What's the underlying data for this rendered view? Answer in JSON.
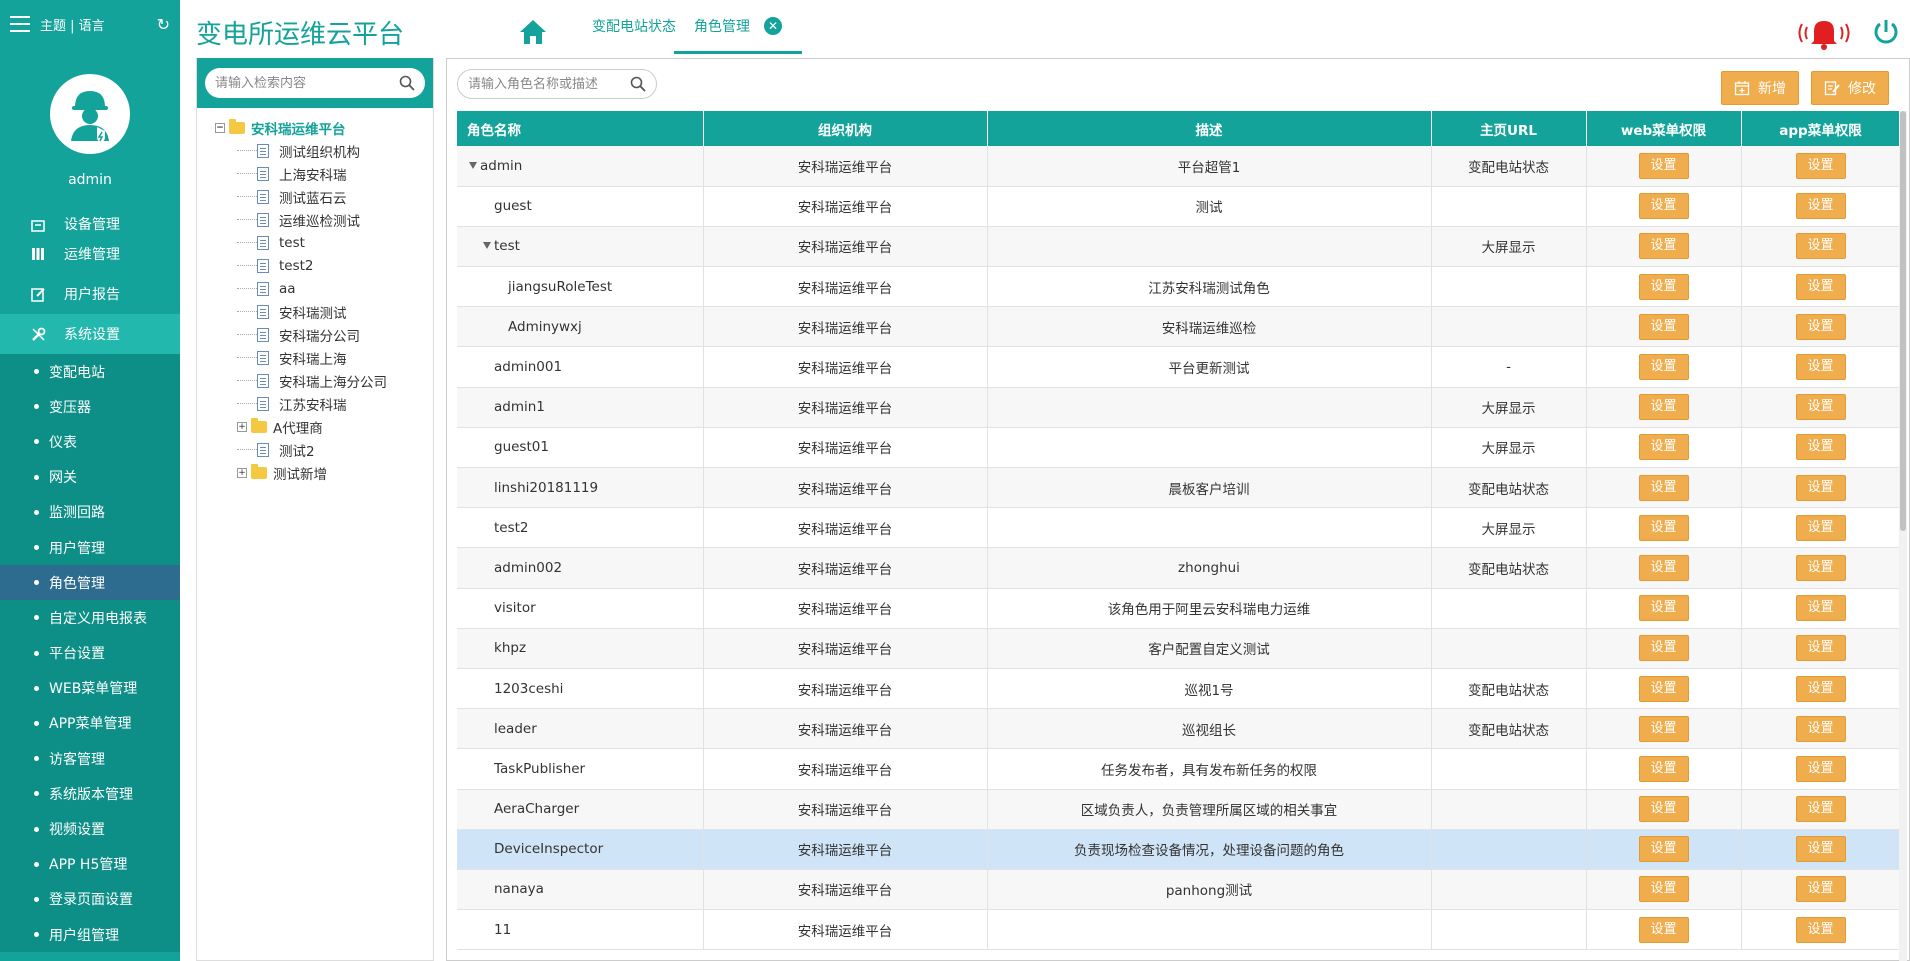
{
  "colors": {
    "brand": "#14a39a",
    "button": "#f0ad4e",
    "active_sub": "#2d6b8f",
    "selected_row": "#cfe4f6"
  },
  "sidebar": {
    "top_label": "主题 | 语言",
    "username": "admin",
    "main_menu": [
      {
        "label": "设备管理",
        "icon": "device-icon"
      },
      {
        "label": "运维管理",
        "icon": "grid-icon"
      },
      {
        "label": "用户报告",
        "icon": "edit-icon"
      },
      {
        "label": "系统设置",
        "icon": "tools-icon"
      }
    ],
    "sub_menu": [
      "变配电站",
      "变压器",
      "仪表",
      "网关",
      "监测回路",
      "用户管理",
      "角色管理",
      "自定义用电报表",
      "平台设置",
      "WEB菜单管理",
      "APP菜单管理",
      "访客管理",
      "系统版本管理",
      "视频设置",
      "APP H5管理",
      "登录页面设置",
      "用户组管理"
    ],
    "active_sub": "角色管理"
  },
  "header": {
    "title": "变电所运维云平台",
    "tabs": [
      {
        "label": "变配电站状态"
      },
      {
        "label": "角色管理"
      }
    ]
  },
  "tree": {
    "search_placeholder": "请输入检索内容",
    "root": "安科瑞运维平台",
    "nodes": [
      {
        "label": "测试组织机构",
        "type": "doc"
      },
      {
        "label": "上海安科瑞",
        "type": "doc"
      },
      {
        "label": "测试蓝石云",
        "type": "doc"
      },
      {
        "label": "运维巡检测试",
        "type": "doc"
      },
      {
        "label": "test",
        "type": "doc"
      },
      {
        "label": "test2",
        "type": "doc"
      },
      {
        "label": "aa",
        "type": "doc"
      },
      {
        "label": "安科瑞测试",
        "type": "doc"
      },
      {
        "label": "安科瑞分公司",
        "type": "doc"
      },
      {
        "label": "安科瑞上海",
        "type": "doc"
      },
      {
        "label": "安科瑞上海分公司",
        "type": "doc"
      },
      {
        "label": "江苏安科瑞",
        "type": "doc"
      },
      {
        "label": "A代理商",
        "type": "folder"
      },
      {
        "label": "测试2",
        "type": "doc"
      },
      {
        "label": "测试新增",
        "type": "folder"
      }
    ]
  },
  "toolbar": {
    "search_placeholder": "请输入角色名称或描述",
    "add_label": "新增",
    "edit_label": "修改"
  },
  "table": {
    "columns": [
      "角色名称",
      "组织机构",
      "描述",
      "主页URL",
      "web菜单权限",
      "app菜单权限"
    ],
    "set_label": "设置",
    "rows": [
      {
        "name": "admin",
        "level": 0,
        "caret": true,
        "org": "安科瑞运维平台",
        "desc": "平台超管1",
        "url": "变配电站状态"
      },
      {
        "name": "guest",
        "level": 1,
        "caret": false,
        "org": "安科瑞运维平台",
        "desc": "测试",
        "url": ""
      },
      {
        "name": "test",
        "level": 1,
        "caret": true,
        "org": "安科瑞运维平台",
        "desc": "",
        "url": "大屏显示"
      },
      {
        "name": "jiangsuRoleTest",
        "level": 2,
        "caret": false,
        "org": "安科瑞运维平台",
        "desc": "江苏安科瑞测试角色",
        "url": ""
      },
      {
        "name": "Adminywxj",
        "level": 2,
        "caret": false,
        "org": "安科瑞运维平台",
        "desc": "安科瑞运维巡检",
        "url": ""
      },
      {
        "name": "admin001",
        "level": 1,
        "caret": false,
        "org": "安科瑞运维平台",
        "desc": "平台更新测试",
        "url": "-"
      },
      {
        "name": "admin1",
        "level": 1,
        "caret": false,
        "org": "安科瑞运维平台",
        "desc": "",
        "url": "大屏显示"
      },
      {
        "name": "guest01",
        "level": 1,
        "caret": false,
        "org": "安科瑞运维平台",
        "desc": "",
        "url": "大屏显示"
      },
      {
        "name": "linshi20181119",
        "level": 1,
        "caret": false,
        "org": "安科瑞运维平台",
        "desc": "晨板客户培训",
        "url": "变配电站状态"
      },
      {
        "name": "test2",
        "level": 1,
        "caret": false,
        "org": "安科瑞运维平台",
        "desc": "",
        "url": "大屏显示"
      },
      {
        "name": "admin002",
        "level": 1,
        "caret": false,
        "org": "安科瑞运维平台",
        "desc": "zhonghui",
        "url": "变配电站状态"
      },
      {
        "name": "visitor",
        "level": 1,
        "caret": false,
        "org": "安科瑞运维平台",
        "desc": "该角色用于阿里云安科瑞电力运维",
        "url": ""
      },
      {
        "name": "khpz",
        "level": 1,
        "caret": false,
        "org": "安科瑞运维平台",
        "desc": "客户配置自定义测试",
        "url": ""
      },
      {
        "name": "1203ceshi",
        "level": 1,
        "caret": false,
        "org": "安科瑞运维平台",
        "desc": "巡视1号",
        "url": "变配电站状态"
      },
      {
        "name": "leader",
        "level": 1,
        "caret": false,
        "org": "安科瑞运维平台",
        "desc": "巡视组长",
        "url": "变配电站状态"
      },
      {
        "name": "TaskPublisher",
        "level": 1,
        "caret": false,
        "org": "安科瑞运维平台",
        "desc": "任务发布者，具有发布新任务的权限",
        "url": ""
      },
      {
        "name": "AeraCharger",
        "level": 1,
        "caret": false,
        "org": "安科瑞运维平台",
        "desc": "区域负责人，负责管理所属区域的相关事宜",
        "url": ""
      },
      {
        "name": "DeviceInspector",
        "level": 1,
        "caret": false,
        "org": "安科瑞运维平台",
        "desc": "负责现场检查设备情况，处理设备问题的角色",
        "url": ""
      },
      {
        "name": "nanaya",
        "level": 1,
        "caret": false,
        "org": "安科瑞运维平台",
        "desc": "panhong测试",
        "url": ""
      },
      {
        "name": "11",
        "level": 1,
        "caret": false,
        "org": "安科瑞运维平台",
        "desc": "",
        "url": ""
      }
    ],
    "selected_index": 17
  }
}
